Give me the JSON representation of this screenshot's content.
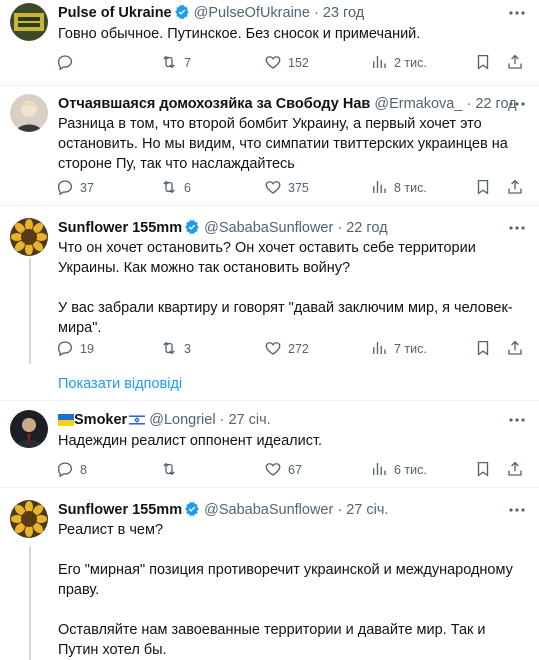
{
  "posts": [
    {
      "name": "Pulse of Ukraine",
      "handle": "@PulseOfUkraine",
      "time": "23 год",
      "text": "Говно обычное. Путинское. Без сносок и примечаний.",
      "replies": "",
      "reposts": "7",
      "likes": "152",
      "views": "2 тис.",
      "verified": true
    },
    {
      "name": "Отчаявшаяся домохозяйка за Свободу Нав",
      "handle": "@Ermakova_",
      "time": "22 год",
      "text": "Разница в том, что второй бомбит Украину, а первый хочет это остановить. Но мы видим, что симпатии твиттерских украинцев на стороне Пу, так что наслаждайтесь",
      "replies": "37",
      "reposts": "6",
      "likes": "375",
      "views": "8 тис.",
      "verified": false
    },
    {
      "name": "Sunflower 155mm",
      "handle": "@SababaSunflower",
      "time": "22 год",
      "text": "Что он хочет остановить? Он хочет оставить себе территории Украины. Как можно так остановить войну?\n\nУ вас забрали квартиру и говорят \"давай заключим мир, я человек-мира\".",
      "replies": "19",
      "reposts": "3",
      "likes": "272",
      "views": "7 тис.",
      "verified": true
    },
    {
      "name": "Smoker",
      "handle": "@Longriel",
      "time": "27 січ.",
      "text": "Надеждин реалист оппонент идеалист.",
      "replies": "8",
      "reposts": "",
      "likes": "67",
      "views": "6 тис.",
      "verified": false
    },
    {
      "name": "Sunflower 155mm",
      "handle": "@SababaSunflower",
      "time": "27 січ.",
      "text": "Реалист в чем?\n\nЕго \"мирная\" позиция противоречит украинской и международному праву.\n\nОставляйте нам завоеванные территории и давайте мир. Так и Путин хотел бы.",
      "verified": true
    }
  ],
  "show_replies": "Показати відповіді",
  "separator": "·",
  "colors": {
    "accent": "#1d9bf0",
    "muted": "#536471",
    "text": "#0f1419"
  }
}
